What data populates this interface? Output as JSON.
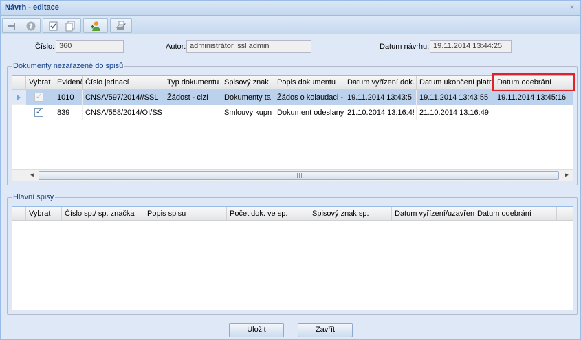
{
  "window": {
    "title": "Návrh - editace",
    "close_glyph": "×"
  },
  "toolbar": {
    "buttons": [
      {
        "icon": "remove-row-icon"
      },
      {
        "icon": "help-icon"
      },
      {
        "icon": "checklist-icon"
      },
      {
        "icon": "copy-icon"
      },
      {
        "icon": "user-add-icon"
      },
      {
        "icon": "print-icon"
      }
    ]
  },
  "form": {
    "cislo_label": "Číslo:",
    "cislo_value": "360",
    "autor_label": "Autor:",
    "autor_value": "administrátor, ssl admin",
    "datum_label": "Datum návrhu:",
    "datum_value": "19.11.2014 13:44:25"
  },
  "documents": {
    "legend": "Dokumenty nezařazené do spisů",
    "columns": [
      "Vybrat",
      "Evidenč",
      "Číslo jednací",
      "Typ dokumentu",
      "Spisový znak",
      "Popis dokumentu",
      "Datum vyřízení dok.",
      "Datum ukončení platr",
      "Datum odebrání"
    ],
    "rows": [
      {
        "selected": true,
        "checked": true,
        "disabled": true,
        "cells": [
          "1010",
          "CNSA/597/2014//SSL",
          "Žádost - cizí",
          "Dokumenty ta",
          "Žádos o kolaudaci -",
          "19.11.2014 13:43:5!",
          "19.11.2014 13:43:55",
          "19.11.2014 13:45:16"
        ]
      },
      {
        "selected": false,
        "checked": true,
        "disabled": false,
        "cells": [
          "839",
          "CNSA/558/2014/OI/SS",
          "",
          "Smlouvy kupn",
          "Dokument odeslany",
          "21.10.2014 13:16:4!",
          "21.10.2014 13:16:49",
          ""
        ]
      }
    ],
    "scroll_left": "◄",
    "scroll_right": "►"
  },
  "main_files": {
    "legend": "Hlavní spisy",
    "columns": [
      "Vybrat",
      "Číslo sp./ sp. značka",
      "Popis spisu",
      "Počet dok. ve sp.",
      "Spisový znak sp.",
      "Datum vyřízení/uzavřen",
      "Datum odebrání"
    ]
  },
  "actions": {
    "save": "Uložit",
    "close": "Zavřít"
  },
  "colors": {
    "highlight": "#e0232b",
    "window_bg": "#dfe8f6",
    "selected_row": "#bcd1ec"
  }
}
